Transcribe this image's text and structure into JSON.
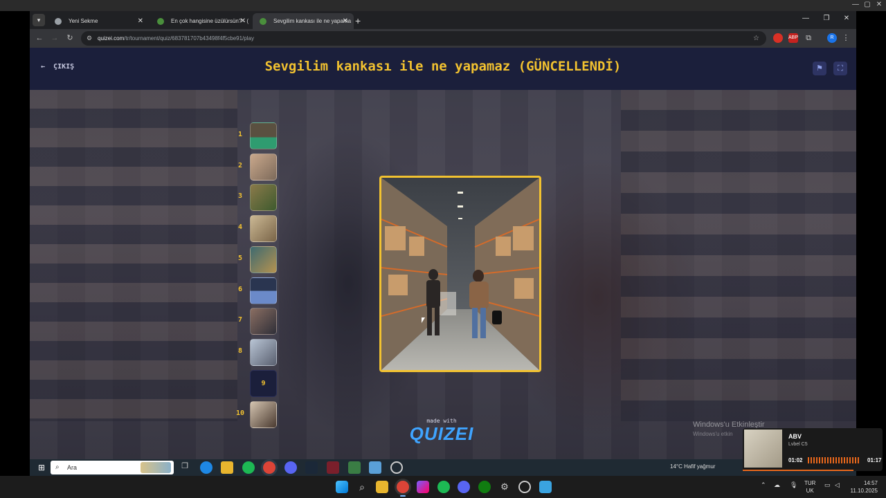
{
  "os": {
    "window_controls": [
      "—",
      "▢",
      "✕"
    ]
  },
  "browser": {
    "tabs": [
      {
        "title": "Yeni Sekme",
        "favicon_color": "#9aa0a6",
        "active": false
      },
      {
        "title": "En çok hangisine üzülürsün? - (",
        "favicon_color": "#4a8f3c",
        "active": false
      },
      {
        "title": "Sevgilim kankası ile ne yapama",
        "favicon_color": "#4a8f3c",
        "active": true
      }
    ],
    "new_tab_label": "+",
    "url_host": "quizei.com",
    "url_path": "/tr/tournament/quiz/683781707b43498f4f5cbe91/play",
    "profile_initial": "R",
    "extensions": [
      {
        "name": "red-circle-extension",
        "color": "#d93025",
        "label": ""
      },
      {
        "name": "adblock-extension",
        "color": "#c5221f",
        "label": "ABP"
      }
    ]
  },
  "quiz": {
    "exit_label": "ÇIKIŞ",
    "title": "Sevgilim kankası ile ne yapamaz (GÜNCELLENDİ)",
    "accent_color": "#f2c230",
    "rounds": [
      {
        "number": "1",
        "thumb_colors": [
          "#5a5040",
          "#2f9c70"
        ]
      },
      {
        "number": "2",
        "thumb_colors": [
          "#c9a88c",
          "#7d6a5a"
        ]
      },
      {
        "number": "3",
        "thumb_colors": [
          "#8a7a4a",
          "#3e5a2e"
        ]
      },
      {
        "number": "4",
        "thumb_colors": [
          "#cbb894",
          "#7a6548"
        ]
      },
      {
        "number": "5",
        "thumb_colors": [
          "#3e6a70",
          "#b59250"
        ]
      },
      {
        "number": "6",
        "thumb_colors": [
          "#2a3550",
          "#6b8ac9"
        ]
      },
      {
        "number": "7",
        "thumb_colors": [
          "#8a6e62",
          "#2f2f38"
        ]
      },
      {
        "number": "8",
        "thumb_colors": [
          "#b8c4d4",
          "#5a6070"
        ]
      },
      {
        "number": "9",
        "thumb_colors": []
      },
      {
        "number": "10",
        "thumb_colors": [
          "#d4c4b0",
          "#4a3a30"
        ]
      }
    ],
    "made_with": "made with",
    "logo_text": "QUIZEI"
  },
  "watermark": {
    "line1": "Windows'u Etkinleştir",
    "line2": "Windows'u etkin"
  },
  "inner_taskbar": {
    "search_placeholder": "Ara",
    "weather": "14°C  Hafif yağmur"
  },
  "music": {
    "title": "ABV",
    "artist": "Lvbel C5",
    "elapsed": "01:02",
    "remaining": "01:17"
  },
  "taskbar": {
    "lang_top": "TUR",
    "lang_bottom": "UK",
    "time": "14:57",
    "date": "11.10.2025"
  }
}
